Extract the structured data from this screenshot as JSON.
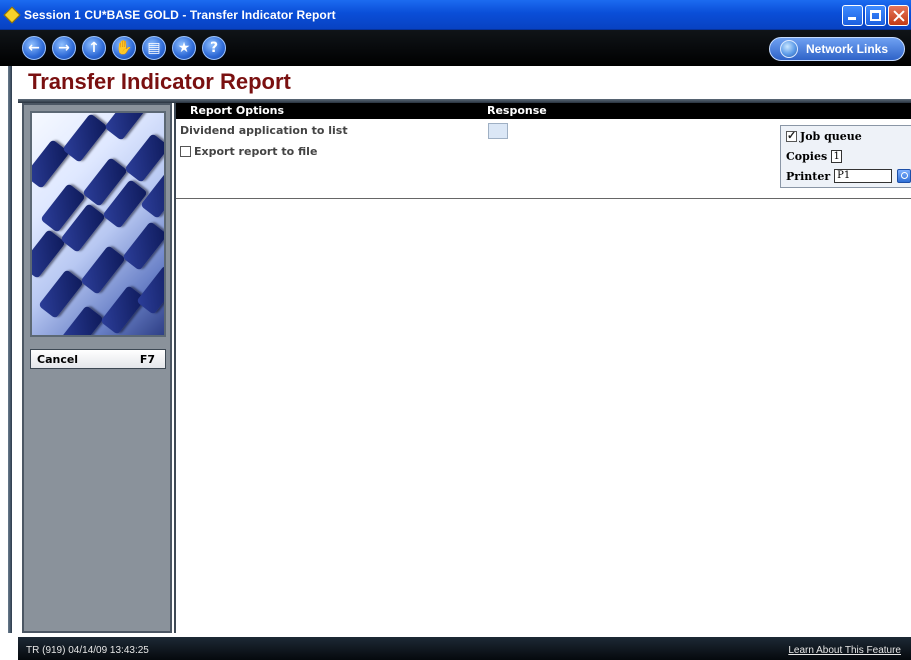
{
  "window": {
    "title": "Session 1 CU*BASE GOLD - Transfer Indicator Report"
  },
  "toolbar": {
    "nav_buttons": [
      {
        "icon": "back-arrow-icon",
        "glyph": "←"
      },
      {
        "icon": "forward-arrow-icon",
        "glyph": "→"
      },
      {
        "icon": "up-arrow-icon",
        "glyph": "↑"
      },
      {
        "icon": "stop-hand-icon",
        "glyph": "✋"
      },
      {
        "icon": "print-icon",
        "glyph": "▤"
      },
      {
        "icon": "favorite-star-icon",
        "glyph": "★"
      },
      {
        "icon": "help-icon",
        "glyph": "?"
      }
    ],
    "network_links_label": "Network Links"
  },
  "header": {
    "title": "Transfer Indicator Report"
  },
  "sidebar": {
    "cancel_label": "Cancel",
    "cancel_key": "F7"
  },
  "main": {
    "columns": {
      "options": "Report Options",
      "response": "Response"
    },
    "options": [
      {
        "label": "Dividend application to list",
        "has_checkbox": false
      },
      {
        "label": "Export report to file",
        "has_checkbox": true,
        "checked": false
      }
    ],
    "job_queue": {
      "job_queue_label": "Job queue",
      "job_queue_checked": true,
      "copies_label": "Copies",
      "copies_value": "1",
      "printer_label": "Printer",
      "printer_value": "P1"
    }
  },
  "footer": {
    "status": "TR (919) 04/14/09 13:43:25",
    "link": "Learn About This Feature"
  },
  "colors": {
    "title_red": "#7a1010",
    "titlebar_blue": "#0a4ed8",
    "sidebar_gray": "#8a929b"
  }
}
